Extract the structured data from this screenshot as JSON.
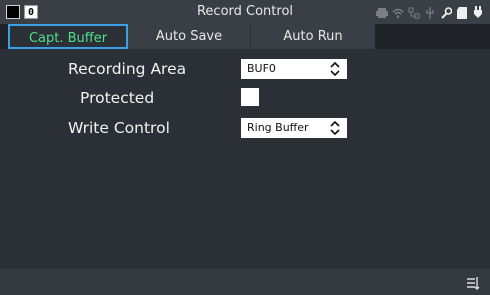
{
  "header": {
    "title": "Record Control",
    "badge": "0",
    "status_icons": [
      "printer-icon",
      "wifi-icon",
      "network-icon",
      "usb-icon",
      "tool-icon",
      "sd-card-icon",
      "power-icon"
    ]
  },
  "tabs": [
    {
      "label": "Capt. Buffer",
      "active": true
    },
    {
      "label": "Auto Save",
      "active": false
    },
    {
      "label": "Auto Run",
      "active": false
    }
  ],
  "settings": {
    "recording_area": {
      "label": "Recording Area",
      "value": "BUF0"
    },
    "protected": {
      "label": "Protected",
      "checked": false
    },
    "write_control": {
      "label": "Write Control",
      "value": "Ring Buffer"
    }
  },
  "footer": {
    "menu_icon": "menu-icon"
  },
  "colors": {
    "background": "#2b2f36",
    "active_tab_text": "#4fe08a",
    "active_tab_border": "#3aa0e8"
  }
}
